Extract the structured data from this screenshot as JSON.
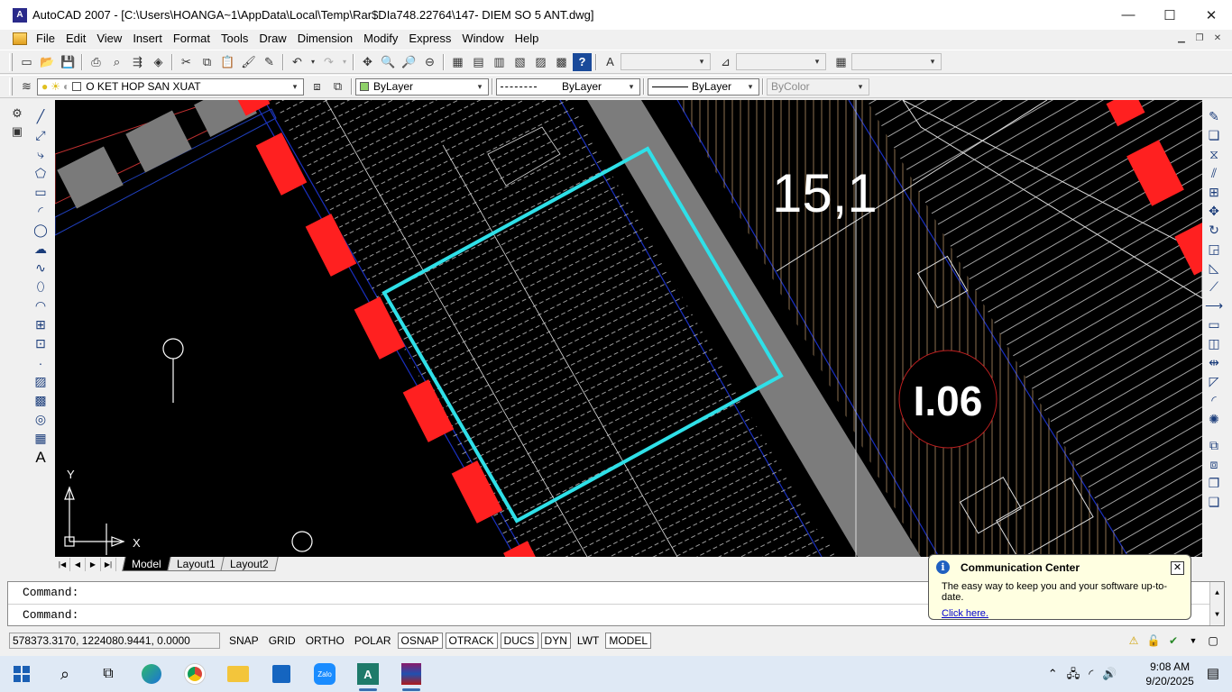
{
  "window": {
    "title": "AutoCAD 2007 - [C:\\Users\\HOANGA~1\\AppData\\Local\\Temp\\Rar$DIa748.22764\\147- DIEM SO 5 ANT.dwg]",
    "minimize": "—",
    "maximize": "☐",
    "close": "✕"
  },
  "menu": {
    "items": [
      "File",
      "Edit",
      "View",
      "Insert",
      "Format",
      "Tools",
      "Draw",
      "Dimension",
      "Modify",
      "Express",
      "Window",
      "Help"
    ]
  },
  "layers": {
    "current_layer": "O KET HOP SAN XUAT",
    "color": "ByLayer",
    "linetype": "ByLayer",
    "lineweight": "ByLayer",
    "plotstyle": "ByColor"
  },
  "drawing": {
    "label_area": "15,1",
    "label_lot": "I.06",
    "ucs_x": "X",
    "ucs_y": "Y"
  },
  "tabs": [
    {
      "label": "Model",
      "active": true
    },
    {
      "label": "Layout1",
      "active": false
    },
    {
      "label": "Layout2",
      "active": false
    }
  ],
  "command": {
    "line1": "Command:",
    "line2": "Command:"
  },
  "status": {
    "coords": "578373.3170, 1224080.9441, 0.0000",
    "toggles": [
      {
        "label": "SNAP",
        "on": false
      },
      {
        "label": "GRID",
        "on": false
      },
      {
        "label": "ORTHO",
        "on": false
      },
      {
        "label": "POLAR",
        "on": false
      },
      {
        "label": "OSNAP",
        "on": true
      },
      {
        "label": "OTRACK",
        "on": true
      },
      {
        "label": "DUCS",
        "on": true
      },
      {
        "label": "DYN",
        "on": true
      },
      {
        "label": "LWT",
        "on": false
      },
      {
        "label": "MODEL",
        "on": true
      }
    ]
  },
  "balloon": {
    "title": "Communication Center",
    "body": "The easy way to keep you and your software up-to-date.",
    "link": "Click here."
  },
  "taskbar": {
    "time": "9:08 AM",
    "date": "9/20/2025"
  }
}
